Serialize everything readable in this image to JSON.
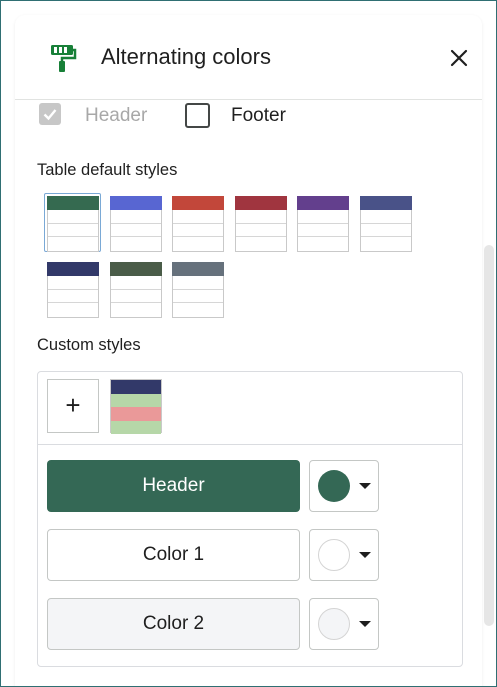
{
  "panel": {
    "title": "Alternating colors",
    "title_icon": "paint-roller-icon",
    "close_icon": "close-icon"
  },
  "checkboxes": {
    "header": {
      "label": "Header",
      "checked": true,
      "disabled": true
    },
    "footer": {
      "label": "Footer",
      "checked": false
    }
  },
  "default_styles": {
    "title": "Table default styles",
    "swatches": [
      {
        "header": "#356a50",
        "alt": "#ffffff",
        "selected": true
      },
      {
        "header": "#5866d2"
      },
      {
        "header": "#c2473a"
      },
      {
        "header": "#a0353f"
      },
      {
        "header": "#633f8d"
      },
      {
        "header": "#495288"
      },
      {
        "header": "#323969"
      },
      {
        "header": "#4a5c48"
      },
      {
        "header": "#66717c"
      }
    ]
  },
  "custom_styles": {
    "title": "Custom styles",
    "add_label": "+",
    "swatch": {
      "header": "#323969",
      "color1": "#b6d7a8",
      "color2": "#ea9999"
    },
    "buttons": {
      "header": {
        "label": "Header",
        "color": "#346855"
      },
      "color1": {
        "label": "Color 1",
        "color": "#ffffff"
      },
      "color2": {
        "label": "Color 2",
        "color": "#f4f5f7"
      }
    }
  }
}
